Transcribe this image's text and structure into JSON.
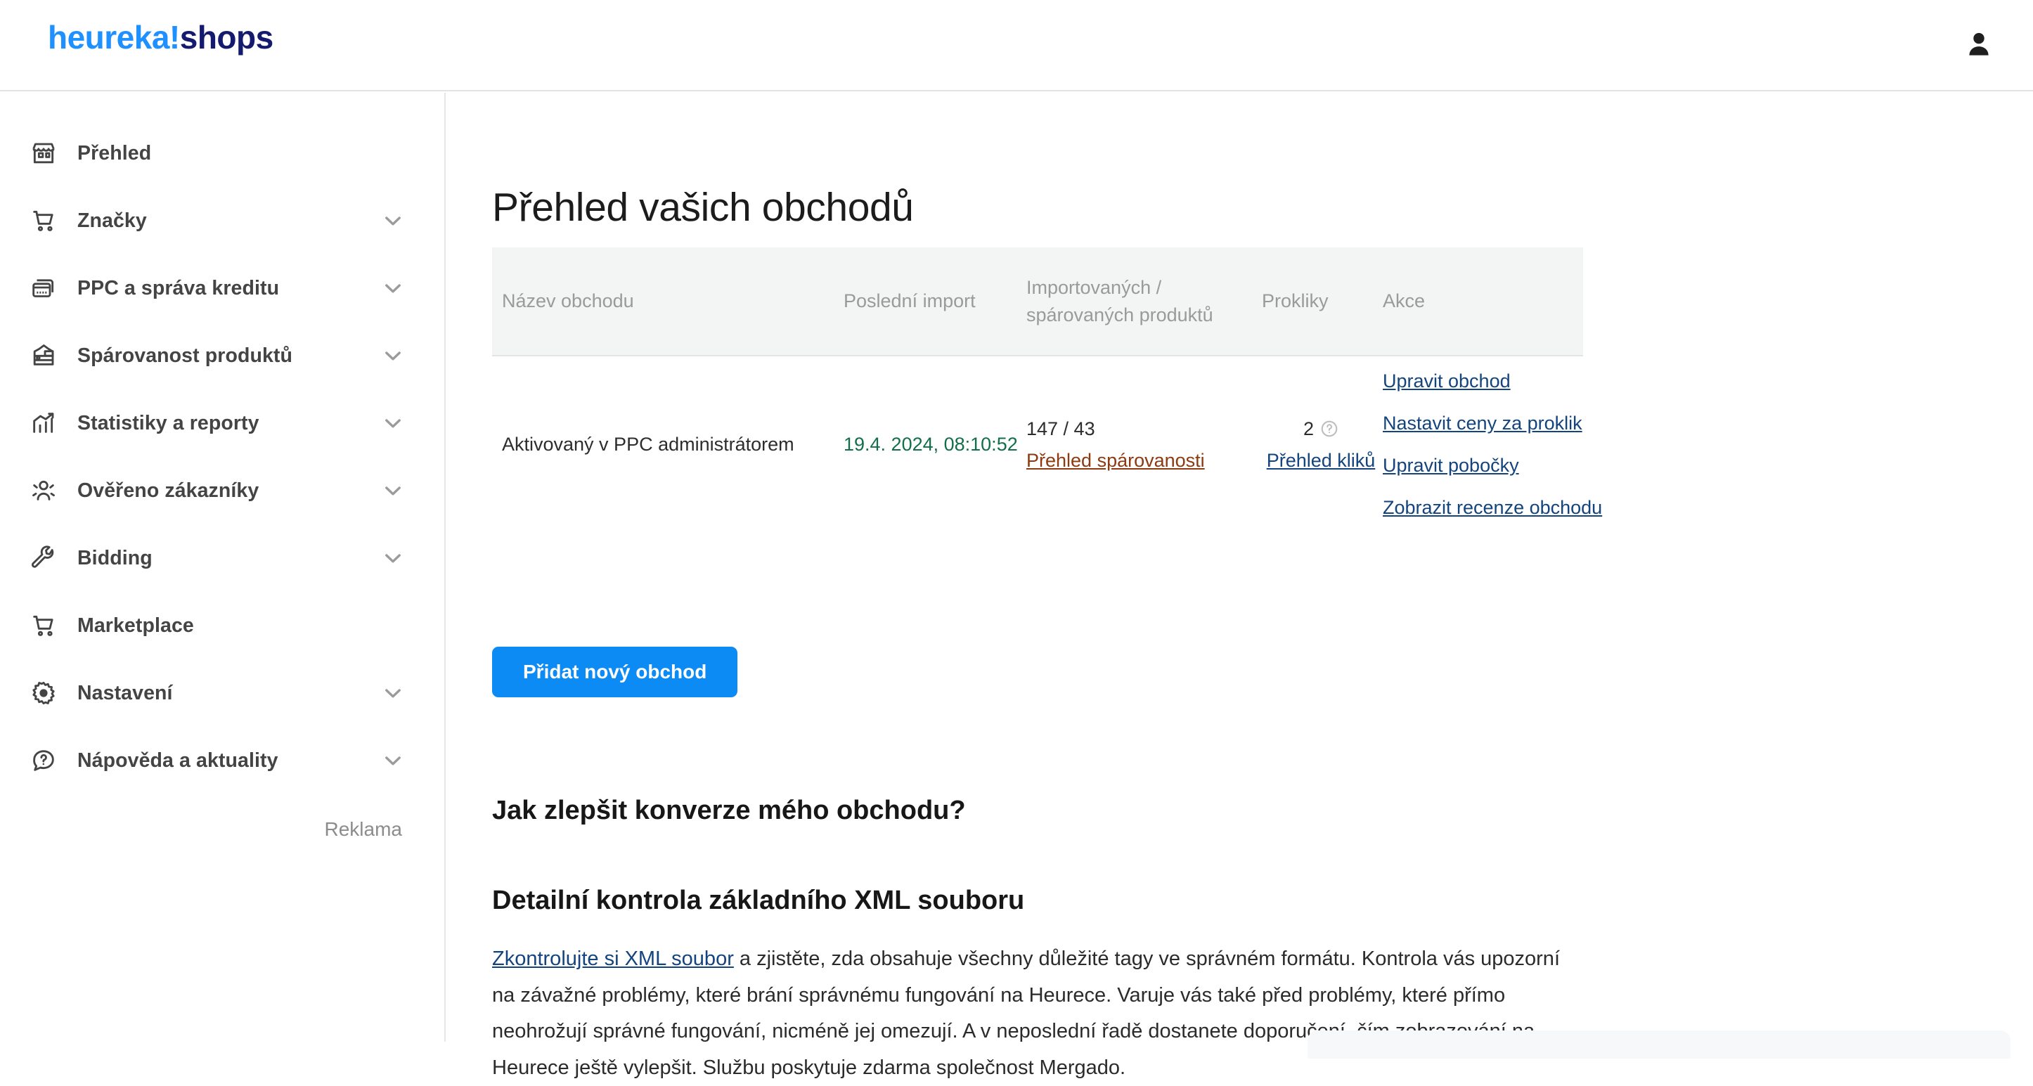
{
  "header": {
    "logo_primary": "heureka!",
    "logo_secondary": "shops",
    "logo_primary_color": "#1e90ff",
    "logo_secondary_color": "#141b6e",
    "avatar_icon": "user-icon"
  },
  "sidebar": {
    "ad_label": "Reklama",
    "items": [
      {
        "label": "Přehled",
        "icon": "storefront-icon",
        "expandable": false
      },
      {
        "label": "Značky",
        "icon": "cart-icon",
        "expandable": true
      },
      {
        "label": "PPC a správa kreditu",
        "icon": "credit-card-icon",
        "expandable": true
      },
      {
        "label": "Spárovanost produktů",
        "icon": "products-icon",
        "expandable": true
      },
      {
        "label": "Statistiky a reporty",
        "icon": "chart-up-icon",
        "expandable": true
      },
      {
        "label": "Ověřeno zákazníky",
        "icon": "users-badge-icon",
        "expandable": true
      },
      {
        "label": "Bidding",
        "icon": "wrench-icon",
        "expandable": true
      },
      {
        "label": "Marketplace",
        "icon": "cart-icon",
        "expandable": false
      },
      {
        "label": "Nastavení",
        "icon": "gear-icon",
        "expandable": true
      },
      {
        "label": "Nápověda a aktuality",
        "icon": "help-chat-icon",
        "expandable": true
      }
    ]
  },
  "main": {
    "page_title": "Přehled vašich obchodů",
    "table": {
      "columns": [
        "Název obchodu",
        "Poslední import",
        "Importovaných / spárovaných produktů",
        "Prokliky",
        "Akce"
      ],
      "row": {
        "shop_name": "Aktivovaný v PPC administrátorem",
        "last_import": "19.4. 2024, 08:10:52",
        "products_count": "147 / 43",
        "products_link": "Přehled spárovanosti",
        "clicks_count": "2",
        "clicks_help_icon": "question-circle-icon",
        "clicks_link": "Přehled kliků",
        "actions": [
          "Upravit obchod",
          "Nastavit ceny za proklik",
          "Upravit pobočky",
          "Zobrazit recenze obchodu"
        ]
      }
    },
    "add_shop_button": "Přidat nový obchod",
    "article": {
      "heading": "Jak zlepšit konverze mého obchodu?",
      "subheading": "Detailní kontrola základního XML souboru",
      "paragraph_link": "Zkontrolujte si XML soubor",
      "paragraph_rest": " a zjistěte, zda obsahuje všechny důležité tagy ve správném formátu. Kontrola vás upozorní na závažné problémy, které brání správnému fungování na Heurece. Varuje vás také před problémy, které přímo neohrožují správné fungování, nicméně jej omezují. A v neposlední řadě dostanete doporučení, čím zobrazování na Heurece ještě vylepšit. Službu poskytuje zdarma společnost Mergado."
    }
  },
  "colors": {
    "accent_blue": "#0d8bf5",
    "link_blue": "#13447e",
    "link_red": "#8c3a10",
    "date_green": "#136f4b",
    "table_head_bg": "#f3f4f4"
  }
}
